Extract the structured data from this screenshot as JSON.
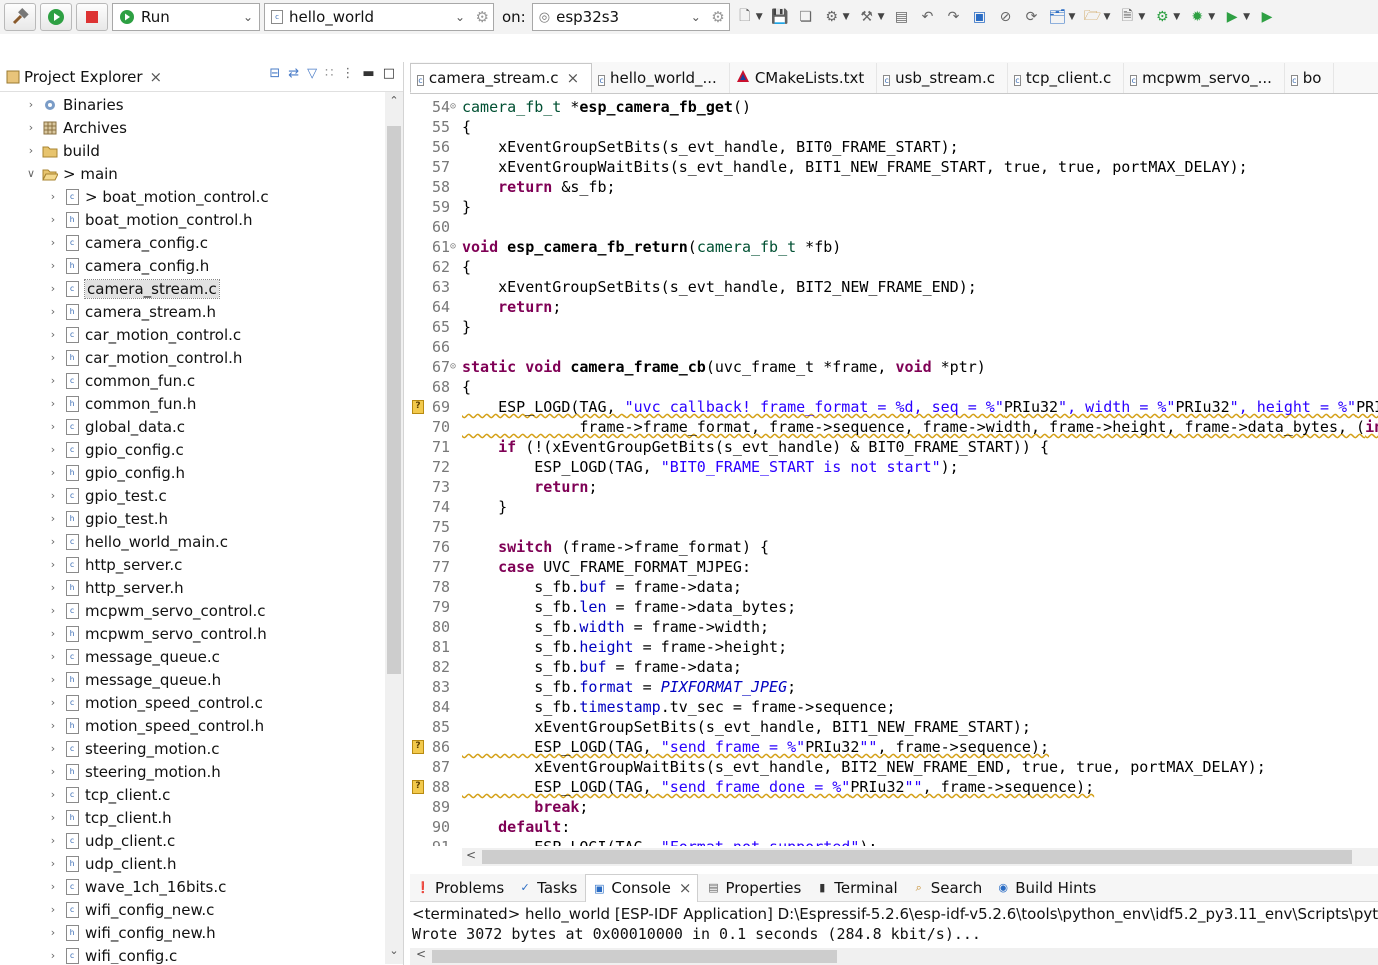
{
  "toolbar": {
    "run_mode": "Run",
    "launch_config": "hello_world",
    "on_label": "on:",
    "target": "esp32s3"
  },
  "project_explorer": {
    "title": "Project Explorer",
    "items": [
      {
        "label": "Binaries",
        "icon": "binaries-icon",
        "indent": 0,
        "expanded": false
      },
      {
        "label": "Archives",
        "icon": "archives-icon",
        "indent": 0,
        "expanded": false
      },
      {
        "label": "build",
        "icon": "folder-icon",
        "indent": 0,
        "expanded": false
      },
      {
        "label": "> main",
        "icon": "folder-open-icon",
        "indent": 0,
        "expanded": true
      },
      {
        "label": "> boat_motion_control.c",
        "icon": "c-file-icon",
        "indent": 1
      },
      {
        "label": "boat_motion_control.h",
        "icon": "h-file-icon",
        "indent": 1
      },
      {
        "label": "camera_config.c",
        "icon": "c-file-icon",
        "indent": 1
      },
      {
        "label": "camera_config.h",
        "icon": "h-file-icon",
        "indent": 1
      },
      {
        "label": "camera_stream.c",
        "icon": "c-file-icon",
        "indent": 1,
        "selected": true
      },
      {
        "label": "camera_stream.h",
        "icon": "h-file-icon",
        "indent": 1
      },
      {
        "label": "car_motion_control.c",
        "icon": "c-file-icon",
        "indent": 1
      },
      {
        "label": "car_motion_control.h",
        "icon": "h-file-icon",
        "indent": 1
      },
      {
        "label": "common_fun.c",
        "icon": "c-file-icon",
        "indent": 1
      },
      {
        "label": "common_fun.h",
        "icon": "h-file-icon",
        "indent": 1
      },
      {
        "label": "global_data.c",
        "icon": "c-file-icon",
        "indent": 1
      },
      {
        "label": "gpio_config.c",
        "icon": "c-file-icon",
        "indent": 1
      },
      {
        "label": "gpio_config.h",
        "icon": "h-file-icon",
        "indent": 1
      },
      {
        "label": "gpio_test.c",
        "icon": "c-file-icon",
        "indent": 1
      },
      {
        "label": "gpio_test.h",
        "icon": "h-file-icon",
        "indent": 1
      },
      {
        "label": "hello_world_main.c",
        "icon": "c-file-icon",
        "indent": 1
      },
      {
        "label": "http_server.c",
        "icon": "c-file-icon",
        "indent": 1
      },
      {
        "label": "http_server.h",
        "icon": "h-file-icon",
        "indent": 1
      },
      {
        "label": "mcpwm_servo_control.c",
        "icon": "c-file-icon",
        "indent": 1
      },
      {
        "label": "mcpwm_servo_control.h",
        "icon": "h-file-icon",
        "indent": 1
      },
      {
        "label": "message_queue.c",
        "icon": "c-file-icon",
        "indent": 1
      },
      {
        "label": "message_queue.h",
        "icon": "h-file-icon",
        "indent": 1
      },
      {
        "label": "motion_speed_control.c",
        "icon": "c-file-icon",
        "indent": 1
      },
      {
        "label": "motion_speed_control.h",
        "icon": "h-file-icon",
        "indent": 1
      },
      {
        "label": "steering_motion.c",
        "icon": "c-file-icon",
        "indent": 1
      },
      {
        "label": "steering_motion.h",
        "icon": "h-file-icon",
        "indent": 1
      },
      {
        "label": "tcp_client.c",
        "icon": "c-file-icon",
        "indent": 1
      },
      {
        "label": "tcp_client.h",
        "icon": "h-file-icon",
        "indent": 1
      },
      {
        "label": "udp_client.c",
        "icon": "c-file-icon",
        "indent": 1
      },
      {
        "label": "udp_client.h",
        "icon": "h-file-icon",
        "indent": 1
      },
      {
        "label": "wave_1ch_16bits.c",
        "icon": "c-file-icon",
        "indent": 1
      },
      {
        "label": "wifi_config_new.c",
        "icon": "c-file-icon",
        "indent": 1
      },
      {
        "label": "wifi_config_new.h",
        "icon": "h-file-icon",
        "indent": 1
      },
      {
        "label": "wifi_config.c",
        "icon": "c-file-icon",
        "indent": 1
      }
    ]
  },
  "editor": {
    "tabs": [
      {
        "label": "camera_stream.c",
        "icon": "c-file-icon",
        "active": true
      },
      {
        "label": "hello_world_...",
        "icon": "c-file-icon"
      },
      {
        "label": "CMakeLists.txt",
        "icon": "cmake-icon"
      },
      {
        "label": "usb_stream.c",
        "icon": "c-file-icon"
      },
      {
        "label": "tcp_client.c",
        "icon": "c-file-icon"
      },
      {
        "label": "mcpwm_servo_...",
        "icon": "c-file-icon"
      },
      {
        "label": "bo",
        "icon": "c-file-icon"
      }
    ],
    "lines": [
      {
        "n": "54",
        "fold": true,
        "t": "camera_fb_t *esp_camera_fb_get()"
      },
      {
        "n": "55",
        "t": "{"
      },
      {
        "n": "56",
        "t": "    xEventGroupSetBits(s_evt_handle, BIT0_FRAME_START);"
      },
      {
        "n": "57",
        "t": "    xEventGroupWaitBits(s_evt_handle, BIT1_NEW_FRAME_START, true, true, portMAX_DELAY);"
      },
      {
        "n": "58",
        "t": "    return &s_fb;"
      },
      {
        "n": "59",
        "t": "}"
      },
      {
        "n": "60",
        "t": ""
      },
      {
        "n": "61",
        "fold": true,
        "t": "void esp_camera_fb_return(camera_fb_t *fb)"
      },
      {
        "n": "62",
        "t": "{"
      },
      {
        "n": "63",
        "t": "    xEventGroupSetBits(s_evt_handle, BIT2_NEW_FRAME_END);"
      },
      {
        "n": "64",
        "t": "    return;"
      },
      {
        "n": "65",
        "t": "}"
      },
      {
        "n": "66",
        "t": ""
      },
      {
        "n": "67",
        "fold": true,
        "t": "static void camera_frame_cb(uvc_frame_t *frame, void *ptr)"
      },
      {
        "n": "68",
        "t": "{"
      },
      {
        "n": "69",
        "warn": true,
        "t": "    ESP_LOGD(TAG, \"uvc callback! frame_format = %d, seq = %\"PRIu32\", width = %\"PRIu32\", height = %\"PRIu32\", length = %u, ptr = %d\","
      },
      {
        "n": "70",
        "warnul": true,
        "t": "             frame->frame_format, frame->sequence, frame->width, frame->height, frame->data_bytes, (int) ptr);"
      },
      {
        "n": "71",
        "t": "    if (!(xEventGroupGetBits(s_evt_handle) & BIT0_FRAME_START)) {"
      },
      {
        "n": "72",
        "t": "        ESP_LOGD(TAG, \"BIT0_FRAME_START is not start\");"
      },
      {
        "n": "73",
        "t": "        return;"
      },
      {
        "n": "74",
        "t": "    }"
      },
      {
        "n": "75",
        "t": ""
      },
      {
        "n": "76",
        "t": "    switch (frame->frame_format) {"
      },
      {
        "n": "77",
        "t": "    case UVC_FRAME_FORMAT_MJPEG:"
      },
      {
        "n": "78",
        "t": "        s_fb.buf = frame->data;"
      },
      {
        "n": "79",
        "t": "        s_fb.len = frame->data_bytes;"
      },
      {
        "n": "80",
        "t": "        s_fb.width = frame->width;"
      },
      {
        "n": "81",
        "t": "        s_fb.height = frame->height;"
      },
      {
        "n": "82",
        "t": "        s_fb.buf = frame->data;"
      },
      {
        "n": "83",
        "t": "        s_fb.format = PIXFORMAT_JPEG;"
      },
      {
        "n": "84",
        "t": "        s_fb.timestamp.tv_sec = frame->sequence;"
      },
      {
        "n": "85",
        "t": "        xEventGroupSetBits(s_evt_handle, BIT1_NEW_FRAME_START);"
      },
      {
        "n": "86",
        "warn": true,
        "t": "        ESP_LOGD(TAG, \"send frame = %\"PRIu32\"\", frame->sequence);"
      },
      {
        "n": "87",
        "t": "        xEventGroupWaitBits(s_evt_handle, BIT2_NEW_FRAME_END, true, true, portMAX_DELAY);"
      },
      {
        "n": "88",
        "warn": true,
        "t": "        ESP_LOGD(TAG, \"send frame done = %\"PRIu32\"\", frame->sequence);"
      },
      {
        "n": "89",
        "t": "        break;"
      },
      {
        "n": "90",
        "t": "    default:"
      },
      {
        "n": "91",
        "t": "        ESP_LOGI(TAG, \"Format not supported\");"
      }
    ]
  },
  "bottom_panel": {
    "tabs": [
      {
        "label": "Problems",
        "icon": "problems-icon"
      },
      {
        "label": "Tasks",
        "icon": "tasks-icon"
      },
      {
        "label": "Console",
        "icon": "console-icon",
        "active": true
      },
      {
        "label": "Properties",
        "icon": "properties-icon"
      },
      {
        "label": "Terminal",
        "icon": "terminal-icon"
      },
      {
        "label": "Search",
        "icon": "search-icon"
      },
      {
        "label": "Build Hints",
        "icon": "build-hints-icon"
      }
    ],
    "console_status": "<terminated> hello_world [ESP-IDF Application] D:\\Espressif-5.2.6\\esp-idf-v5.2.6\\tools\\python_env\\idf5.2_py3.11_env\\Scripts\\python.exe",
    "console_output": "Wrote 3072 bytes at 0x00010000 in 0.1 seconds (284.8 kbit/s)..."
  },
  "colors": {
    "keyword": "#7f0055",
    "string": "#2a00ff",
    "field": "#0000c0",
    "enum_italic": "#0000c0",
    "warning_underline": "#d4a017"
  }
}
